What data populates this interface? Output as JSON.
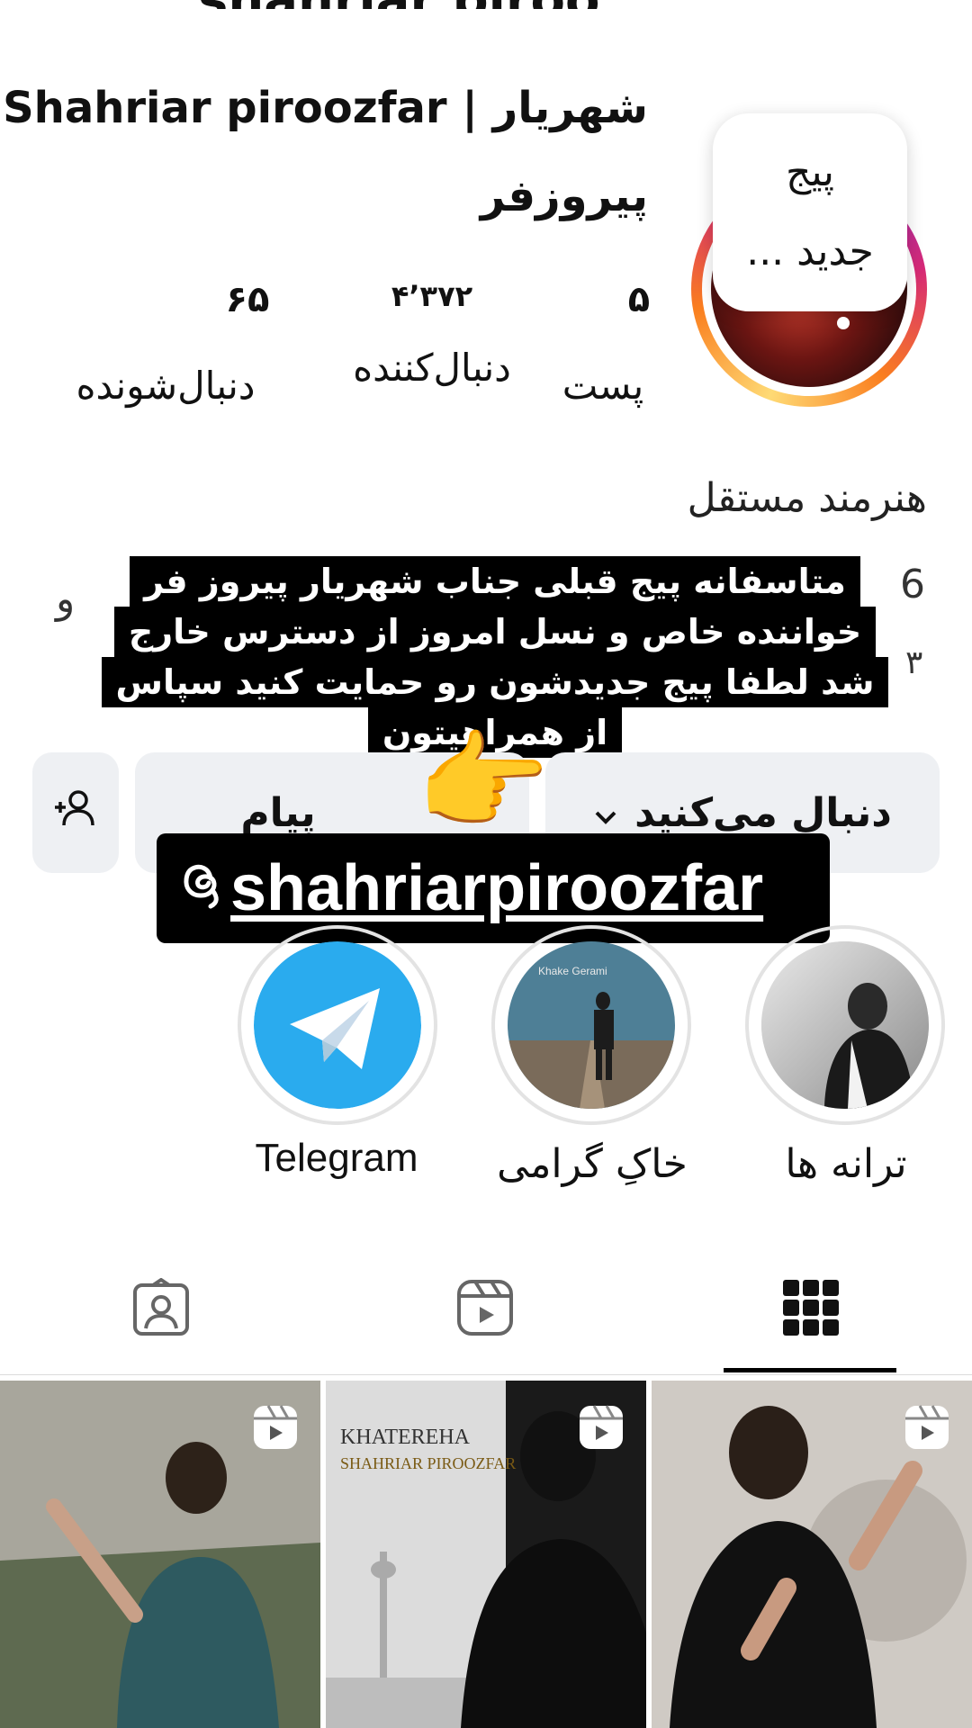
{
  "profile": {
    "name_line1": "Shahriar piroozfar | شهریار",
    "name_line2": "پیروزفر",
    "note": "پیج جدید ...",
    "category": "هنرمند مستقل"
  },
  "stats": {
    "posts": {
      "value": "۵",
      "label": "پست"
    },
    "followers": {
      "value": "۴٬۳۷۲",
      "label": "دنبال‌کننده"
    },
    "following": {
      "value": "۶۵",
      "label": "دنبال‌شونده"
    }
  },
  "bio_peek": {
    "right_top": "6",
    "right_bottom": "۳",
    "left": "و"
  },
  "story_overlay": {
    "message": "متاسفانه پیج قبلی جناب شهریار پیروز فر خواننده خاص و نسل امروز از دسترس خارج شد لطفا پیج جدیدشون رو حمایت کنید سپاس از همراهیتون",
    "handle": "shahriarpiroozfar",
    "emoji": "👉"
  },
  "actions": {
    "following_label": "دنبال می‌کنید",
    "message_label": "پیام"
  },
  "highlights": [
    {
      "label": "ترانه ها",
      "icon": "songs-highlight-photo"
    },
    {
      "label": "خاکِ گرامی",
      "icon": "khake-gerami-highlight-photo"
    },
    {
      "label": "Telegram",
      "icon": "telegram-icon"
    }
  ],
  "highlight_cover_text": {
    "khake_gerami": "Khake Gerami"
  },
  "tabs": [
    "grid-icon",
    "reels-icon",
    "tagged-icon"
  ],
  "posts": [
    {
      "title": "",
      "subtitle": ""
    },
    {
      "title": "KHATEREHA",
      "subtitle": "SHAHRIAR PIROOZFAR"
    },
    {
      "title": "",
      "subtitle": ""
    }
  ],
  "colors": {
    "telegram": "#2AABEE",
    "button_bg": "#eef0f3",
    "overlay_bg": "#000000"
  }
}
